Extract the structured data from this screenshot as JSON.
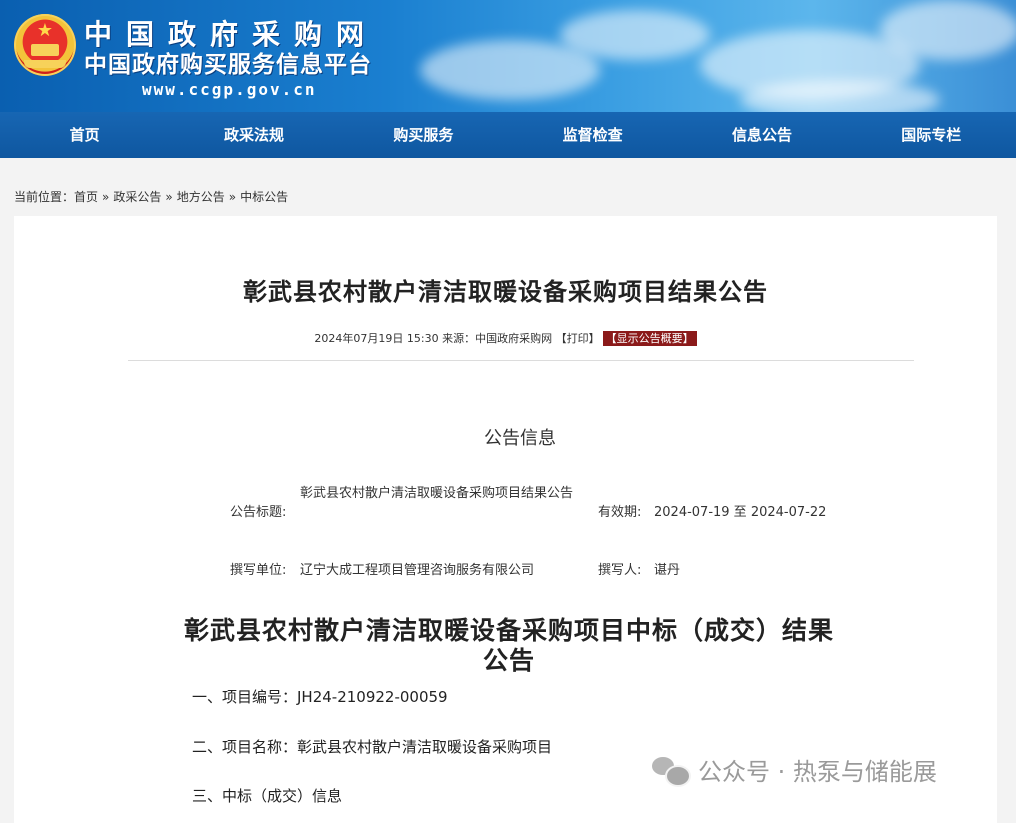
{
  "header": {
    "site_name": "中国政府采购网",
    "site_subtitle": "中国政府购买服务信息平台",
    "site_url": "www.ccgp.gov.cn"
  },
  "nav": {
    "items": [
      "首页",
      "政采法规",
      "购买服务",
      "监督检查",
      "信息公告",
      "国际专栏"
    ]
  },
  "breadcrumb": {
    "prefix": "当前位置：",
    "items": [
      "首页",
      "政采公告",
      "地方公告",
      "中标公告"
    ],
    "separator": "»"
  },
  "notice": {
    "title": "彰武县农村散户清洁取暖设备采购项目结果公告",
    "meta_text": "2024年07月19日 15:30 来源：中国政府采购网",
    "print_label": "【打印】",
    "summary_label": "【显示公告概要】"
  },
  "info": {
    "section_title": "公告信息",
    "title_label": "公告标题:",
    "title_value": "彰武县农村散户清洁取暖设备采购项目结果公告",
    "valid_label": "有效期:",
    "valid_value": "2024-07-19 至 2024-07-22",
    "org_label": "撰写单位:",
    "org_value": "辽宁大成工程项目管理咨询服务有限公司",
    "author_label": "撰写人:",
    "author_value": "谌丹"
  },
  "body": {
    "heading": "彰武县农村散户清洁取暖设备采购项目中标（成交）结果公告",
    "items": [
      "一、项目编号：JH24-210922-00059",
      "二、项目名称：彰武县农村散户清洁取暖设备采购项目",
      "三、中标（成交）信息"
    ]
  },
  "watermark": {
    "text": "公众号 · 热泵与储能展",
    "icon": "wechat-icon"
  },
  "colors": {
    "nav_bg": "#1766b3",
    "summary_btn_bg": "#8b1a1a",
    "page_bg": "#f3f3f3"
  }
}
